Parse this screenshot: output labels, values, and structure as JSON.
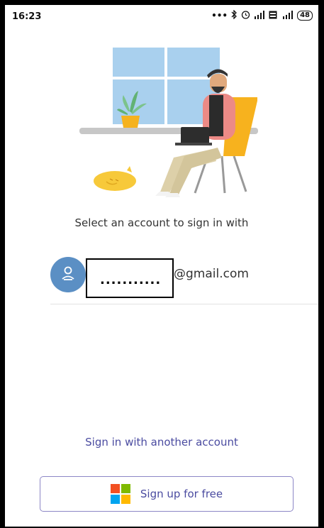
{
  "status_bar": {
    "time": "16:23",
    "icons": [
      "more-dots-icon",
      "bluetooth-icon",
      "alarm-icon",
      "signal-icon",
      "volte-icon",
      "4g-signal-icon",
      "battery-icon"
    ],
    "battery_level": "48"
  },
  "prompt": "Select an account to sign in with",
  "account": {
    "redacted_user": "...........",
    "email_domain": "@gmail.com"
  },
  "another_account_link": "Sign in with another account",
  "signup_button": {
    "label": "Sign up for free",
    "logo_colors": [
      "#f25022",
      "#7fba00",
      "#00a4ef",
      "#ffb900"
    ]
  },
  "colors": {
    "accent": "#4a4ba0",
    "avatar": "#5b8fc4"
  }
}
